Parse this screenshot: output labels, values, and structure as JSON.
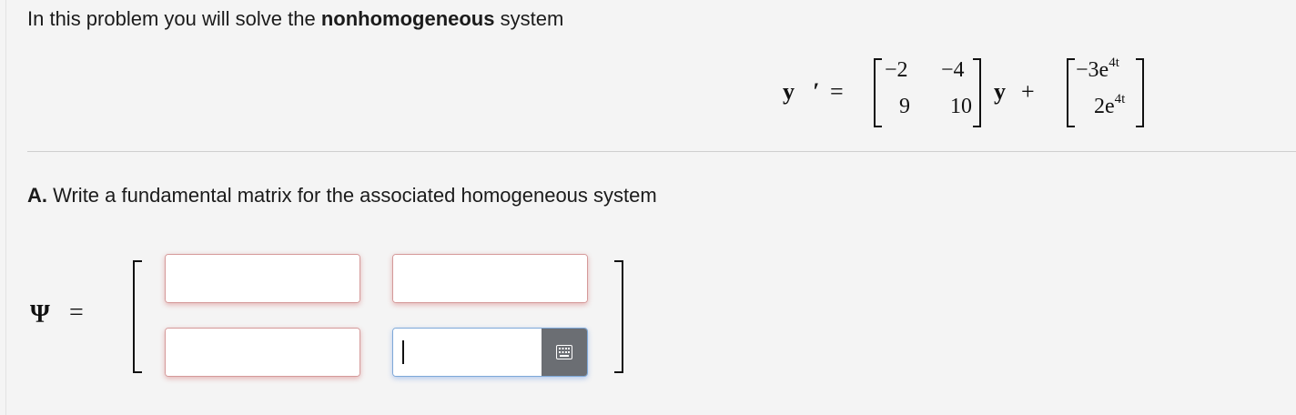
{
  "intro": {
    "prefix": "In this problem you will solve the ",
    "bold": "nonhomogeneous",
    "suffix": " system"
  },
  "equation": {
    "lhs": "y⃗′",
    "equals": "=",
    "matrix": [
      "−2",
      "−4",
      "9",
      "10"
    ],
    "y": "y⃗",
    "plus": "+",
    "forcing": [
      {
        "coef": "−3e",
        "exp": "4t"
      },
      {
        "coef": "2e",
        "exp": "4t"
      }
    ]
  },
  "part_a": {
    "label": "A.",
    "text": " Write a fundamental matrix for the associated homogeneous system"
  },
  "psi": {
    "symbol": "Ψ",
    "equals": "="
  },
  "entries": [
    {
      "value": "",
      "state": "error"
    },
    {
      "value": "",
      "state": "error"
    },
    {
      "value": "",
      "state": "error"
    },
    {
      "value": "",
      "state": "focused"
    }
  ],
  "icons": {
    "keyboard": "keyboard-grid-icon"
  },
  "colors": {
    "error_glow": "#d59a9a",
    "focus_glow": "#7ea8d8",
    "kbd_button": "#6b6e73"
  }
}
